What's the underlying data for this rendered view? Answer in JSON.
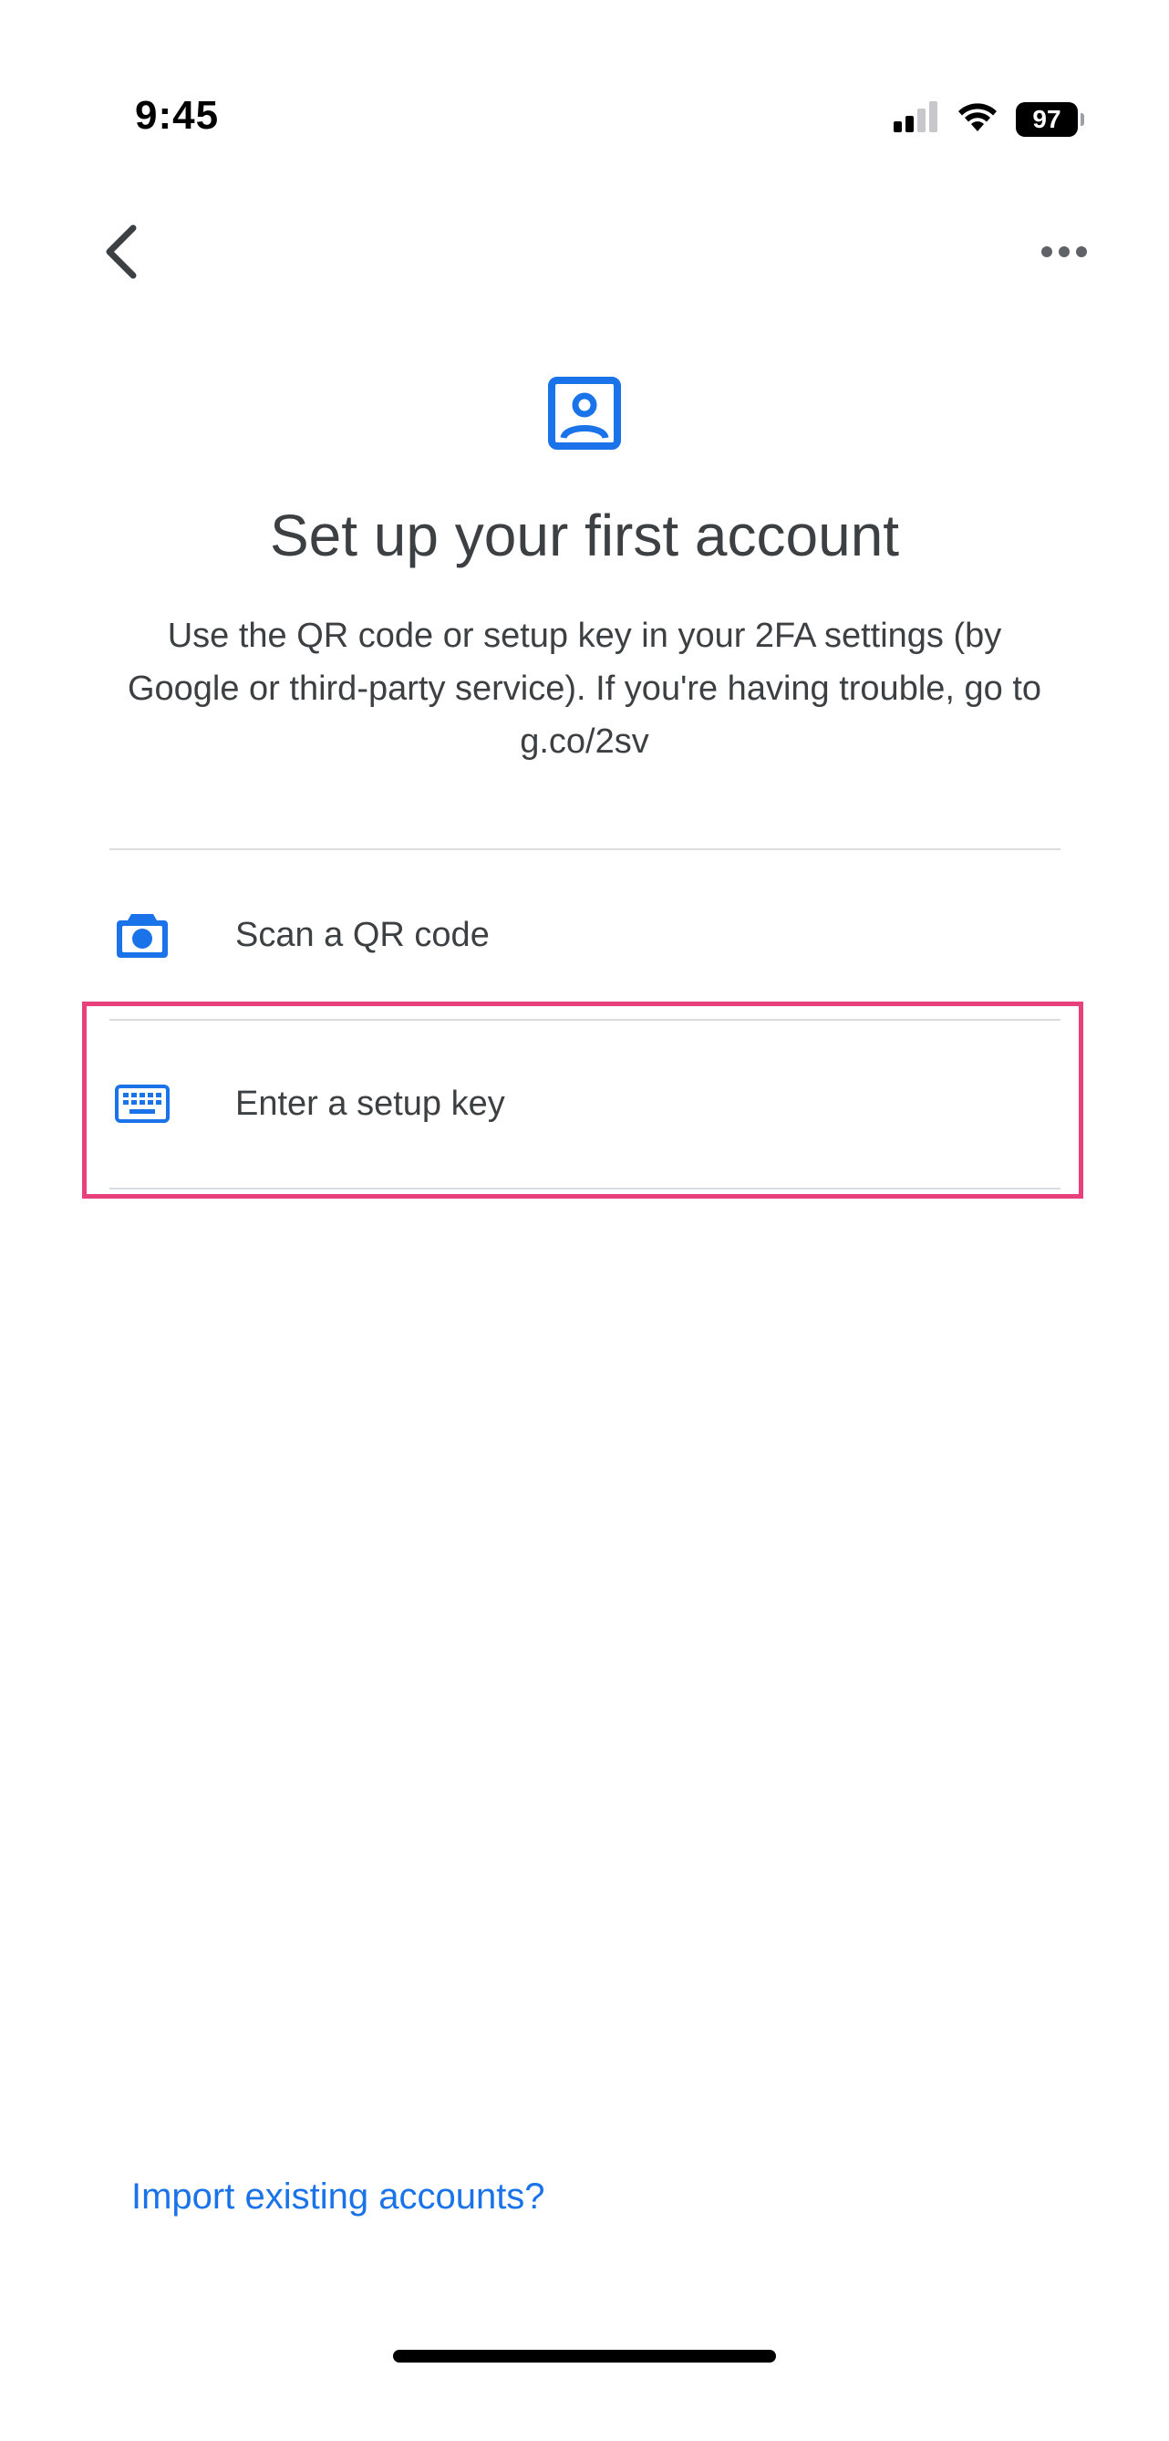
{
  "status_bar": {
    "time": "9:45",
    "battery": "97",
    "icons": [
      "cellular-signal-icon",
      "wifi-icon",
      "battery-icon"
    ]
  },
  "app_bar": {
    "back_icon": "chevron-left-icon",
    "more_icon": "more-horizontal-icon"
  },
  "hero": {
    "icon": "account-box-icon",
    "title": "Set up your first account",
    "subtitle": "Use the QR code or setup key in your 2FA settings (by Google or third-party service). If you're having trouble, go to g.co/2sv"
  },
  "options": [
    {
      "icon": "camera-icon",
      "label": "Scan a QR code"
    },
    {
      "icon": "keyboard-icon",
      "label": "Enter a setup key"
    }
  ],
  "footer": {
    "import_link": "Import existing accounts?"
  },
  "colors": {
    "accent": "#1a73e8",
    "text": "#3c4043",
    "divider": "#dadce0",
    "highlight": "#e8407a"
  }
}
